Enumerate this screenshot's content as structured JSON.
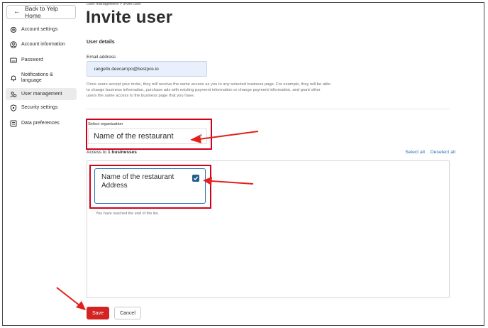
{
  "sidebar": {
    "back_label": "Back to Yelp Home",
    "items": [
      {
        "label": "Account settings",
        "icon": "gear-icon"
      },
      {
        "label": "Account information",
        "icon": "user-circle-icon"
      },
      {
        "label": "Password",
        "icon": "keyboard-icon"
      },
      {
        "label": "Notifications & language",
        "icon": "bell-icon"
      },
      {
        "label": "User management",
        "icon": "users-icon",
        "active": true
      },
      {
        "label": "Security settings",
        "icon": "shield-icon"
      },
      {
        "label": "Data preferences",
        "icon": "data-icon"
      }
    ]
  },
  "breadcrumb": "User management  >  Invite user",
  "page_title": "Invite user",
  "user_details": {
    "heading": "User details",
    "email_label": "Email address",
    "email_value": "iangello.deocampo@bestpos.io",
    "help_text": "Once users accept your invite, they will receive the same access as you to any selected business page. For example, they will be able to change business information, purchase ads with existing payment information or change payment information, and grant other users the same access to the business page that you have."
  },
  "organization": {
    "label": "Select organization",
    "selected": "Name of the restaurant"
  },
  "access": {
    "prefix": "Access to ",
    "count": "1 businesses",
    "select_all": "Select all",
    "deselect_all": "Deselect all"
  },
  "business": {
    "name": "Name of the restaurant",
    "address": "Address",
    "checked": true
  },
  "end_note": "You have reached the end of the list.",
  "actions": {
    "save": "Save",
    "cancel": "Cancel"
  },
  "colors": {
    "brand_red": "#d32323",
    "annotation_red": "#e3201b",
    "link_blue": "#2b6fb4",
    "check_blue": "#1f5f8f",
    "autofill_blue": "#e8f0fe"
  }
}
